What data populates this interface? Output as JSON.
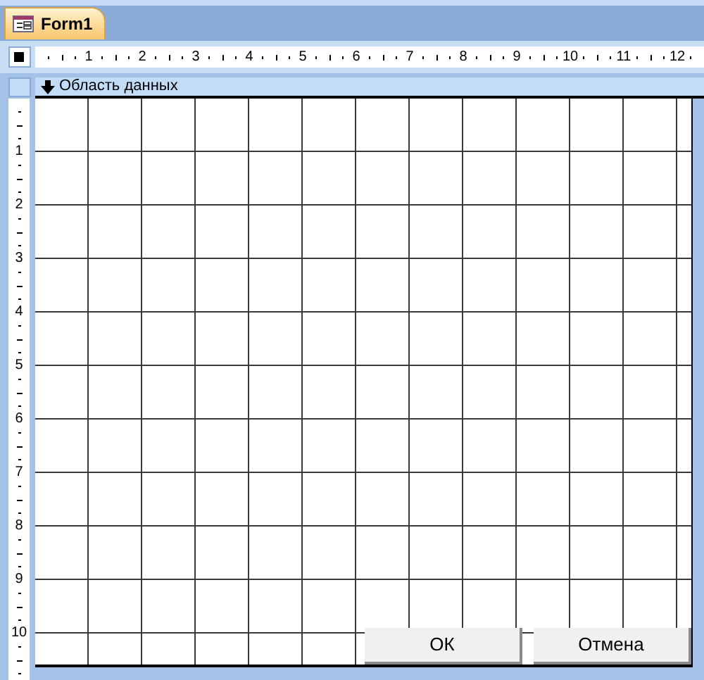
{
  "tab": {
    "title": "Form1",
    "selected": true
  },
  "ruler": {
    "horizontal": [
      "1",
      "2",
      "3",
      "4",
      "5",
      "6",
      "7",
      "8",
      "9",
      "10",
      "11",
      "12"
    ],
    "vertical": [
      "1",
      "2",
      "3",
      "4",
      "5",
      "6",
      "7",
      "8",
      "9",
      "10"
    ]
  },
  "section": {
    "title": "Область данных"
  },
  "buttons": [
    "ОК",
    "Отмена"
  ]
}
